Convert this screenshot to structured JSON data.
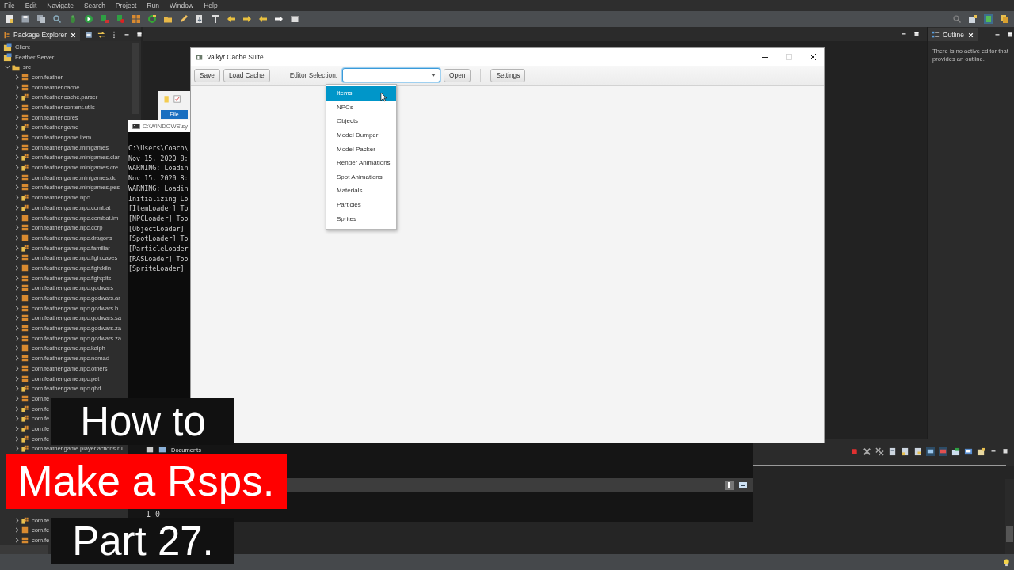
{
  "menu": [
    "File",
    "Edit",
    "Navigate",
    "Search",
    "Project",
    "Run",
    "Window",
    "Help"
  ],
  "package_explorer": {
    "title": "Package Explorer",
    "tree": [
      {
        "label": "Client",
        "kind": "project"
      },
      {
        "label": "Feather Server",
        "kind": "project",
        "children": [
          {
            "label": "src",
            "kind": "folder",
            "expanded": true,
            "children": [
              {
                "label": "com.feather",
                "kind": "plain",
                "expanded": false
              },
              {
                "label": "com.feather.cache",
                "kind": "plain",
                "expanded": false
              },
              {
                "label": "com.feather.cache.parser",
                "kind": "stacked",
                "expanded": false
              },
              {
                "label": "com.feather.content.utils",
                "kind": "plain",
                "expanded": false
              },
              {
                "label": "com.feather.cores",
                "kind": "plain",
                "expanded": false
              },
              {
                "label": "com.feather.game",
                "kind": "stacked",
                "expanded": false
              },
              {
                "label": "com.feather.game.item",
                "kind": "plain",
                "expanded": false
              },
              {
                "label": "com.feather.game.minigames",
                "kind": "plain",
                "expanded": false
              },
              {
                "label": "com.feather.game.minigames.clar",
                "kind": "stacked",
                "expanded": false
              },
              {
                "label": "com.feather.game.minigames.cre",
                "kind": "stacked",
                "expanded": false
              },
              {
                "label": "com.feather.game.minigames.du",
                "kind": "plain",
                "expanded": false
              },
              {
                "label": "com.feather.game.minigames.pes",
                "kind": "plain",
                "expanded": false
              },
              {
                "label": "com.feather.game.npc",
                "kind": "stacked",
                "expanded": false
              },
              {
                "label": "com.feather.game.npc.combat",
                "kind": "stacked",
                "expanded": false
              },
              {
                "label": "com.feather.game.npc.combat.im",
                "kind": "plain",
                "expanded": false
              },
              {
                "label": "com.feather.game.npc.corp",
                "kind": "plain",
                "expanded": false
              },
              {
                "label": "com.feather.game.npc.dragons",
                "kind": "plain",
                "expanded": false
              },
              {
                "label": "com.feather.game.npc.familiar",
                "kind": "stacked",
                "expanded": false
              },
              {
                "label": "com.feather.game.npc.fightcaves",
                "kind": "plain",
                "expanded": false
              },
              {
                "label": "com.feather.game.npc.fightkiln",
                "kind": "plain",
                "expanded": false
              },
              {
                "label": "com.feather.game.npc.fightpits",
                "kind": "plain",
                "expanded": false
              },
              {
                "label": "com.feather.game.npc.godwars",
                "kind": "plain",
                "expanded": false
              },
              {
                "label": "com.feather.game.npc.godwars.ar",
                "kind": "plain",
                "expanded": false
              },
              {
                "label": "com.feather.game.npc.godwars.b",
                "kind": "plain",
                "expanded": false
              },
              {
                "label": "com.feather.game.npc.godwars.sa",
                "kind": "plain",
                "expanded": false
              },
              {
                "label": "com.feather.game.npc.godwars.za",
                "kind": "plain",
                "expanded": false
              },
              {
                "label": "com.feather.game.npc.godwars.za",
                "kind": "plain",
                "expanded": false
              },
              {
                "label": "com.feather.game.npc.kalph",
                "kind": "plain",
                "expanded": false
              },
              {
                "label": "com.feather.game.npc.nomad",
                "kind": "plain",
                "expanded": false
              },
              {
                "label": "com.feather.game.npc.others",
                "kind": "plain",
                "expanded": false
              },
              {
                "label": "com.feather.game.npc.pet",
                "kind": "plain",
                "expanded": false
              },
              {
                "label": "com.feather.game.npc.qbd",
                "kind": "stacked",
                "expanded": false
              },
              {
                "label": "com.fe",
                "kind": "plain",
                "expanded": false
              },
              {
                "label": "com.fe",
                "kind": "stacked",
                "expanded": false
              },
              {
                "label": "com.fe",
                "kind": "stacked",
                "expanded": false
              },
              {
                "label": "com.fe",
                "kind": "stacked",
                "expanded": false
              },
              {
                "label": "com.fe",
                "kind": "stacked",
                "expanded": false
              },
              {
                "label": "com.feather.game.player.actions.ru",
                "kind": "stacked",
                "expanded": false
              }
            ]
          }
        ]
      }
    ],
    "lower_rows": [
      {
        "label": "com.fe",
        "kind": "stacked",
        "expanded": false
      },
      {
        "label": "com.fe",
        "kind": "plain",
        "expanded": false
      },
      {
        "label": "com.fe",
        "kind": "plain",
        "expanded": false
      }
    ]
  },
  "explorer_window": {
    "tab": "File",
    "location": "Documents"
  },
  "console_window": {
    "title": "C:\\WINDOWS\\sy",
    "lines": [
      "C:\\Users\\Coach\\",
      "Nov 15, 2020 8:",
      "WARNING: Loadin",
      "Nov 15, 2020 8:",
      "WARNING: Loadin",
      "Initializing Lo",
      "[ItemLoader] To",
      "[NPCLoader] Too",
      "[ObjectLoader]",
      "[SpotLoader] To",
      "[ParticleLoader",
      "[RASLoader] Too",
      "[SpriteLoader]"
    ],
    "output": "1 0"
  },
  "dialog": {
    "title": "Valkyr Cache Suite",
    "maximizable": false,
    "toolbar": [
      {
        "kind": "button",
        "label": "Save"
      },
      {
        "kind": "button",
        "label": "Load Cache"
      },
      {
        "kind": "separator"
      },
      {
        "kind": "label",
        "label": "Editor Selection:"
      },
      {
        "kind": "combo",
        "expanded": true
      },
      {
        "kind": "button",
        "label": "Open"
      },
      {
        "kind": "separator"
      },
      {
        "kind": "button",
        "label": "Settings"
      }
    ],
    "options": [
      {
        "label": "Items",
        "selected": true
      },
      {
        "label": "NPCs",
        "selected": false
      },
      {
        "label": "Objects",
        "selected": false
      },
      {
        "label": "Model Dumper",
        "selected": false
      },
      {
        "label": "Model Packer",
        "selected": false
      },
      {
        "label": "Render Animations",
        "selected": false
      },
      {
        "label": "Spot Animations",
        "selected": false
      },
      {
        "label": "Materials",
        "selected": false
      },
      {
        "label": "Particles",
        "selected": false
      },
      {
        "label": "Sprites",
        "selected": false
      }
    ]
  },
  "outline": {
    "title": "Outline",
    "message": "There is no active editor that provides an outline."
  },
  "title_card": [
    {
      "text": "How to",
      "kind": "dark"
    },
    {
      "text": "Make a Rsps.",
      "kind": "red"
    },
    {
      "text": "Part 27.",
      "kind": "dark"
    }
  ]
}
